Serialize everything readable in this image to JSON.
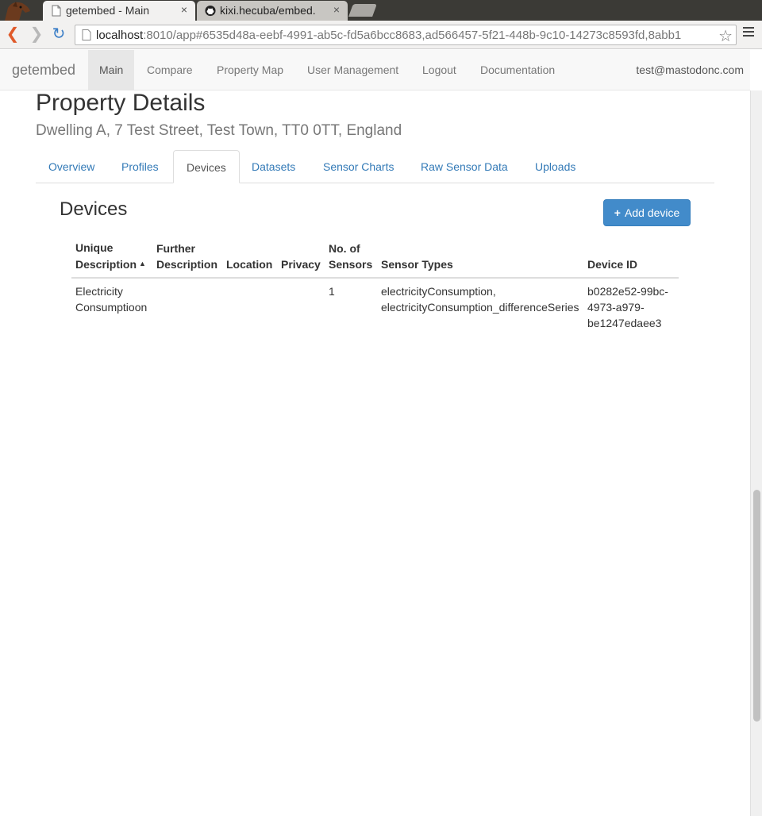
{
  "browser": {
    "tabs": [
      {
        "title": "getembed - Main",
        "close": "×",
        "icon": "page-icon"
      },
      {
        "title": "kixi.hecuba/embed.",
        "close": "×",
        "icon": "github-icon"
      }
    ],
    "url_host": "localhost",
    "url_rest": ":8010/app#6535d48a-eebf-4991-ab5c-fd5a6bcc8683,ad566457-5f21-448b-9c10-14273c8593fd,8abb1",
    "back": "❮",
    "forward": "❯",
    "reload": "↻",
    "star": "☆"
  },
  "navbar": {
    "brand": "getembed",
    "items": [
      "Main",
      "Compare",
      "Property Map",
      "User Management",
      "Logout",
      "Documentation"
    ],
    "active": "Main",
    "user": "test@mastodonc.com"
  },
  "page": {
    "title": "Property Details",
    "subtitle": "Dwelling A, 7 Test Street, Test Town, TT0 0TT, England",
    "tabs": [
      "Overview",
      "Profiles",
      "Devices",
      "Datasets",
      "Sensor Charts",
      "Raw Sensor Data",
      "Uploads"
    ],
    "active_tab": "Devices"
  },
  "devices": {
    "title": "Devices",
    "add_button": {
      "icon": "+",
      "label": "Add device"
    },
    "columns": {
      "unique_description": [
        "Unique",
        "Description"
      ],
      "further_description": [
        "Further",
        "Description"
      ],
      "location": "Location",
      "privacy": "Privacy",
      "no_of_sensors": [
        "No. of",
        "Sensors"
      ],
      "sensor_types": "Sensor Types",
      "device_id": "Device ID"
    },
    "sort_indicator": "▲",
    "rows": [
      {
        "unique_description": [
          "Electricity",
          "Consumptioon"
        ],
        "further_description": "",
        "location": "",
        "privacy": "",
        "no_of_sensors": "1",
        "sensor_types": [
          "electricityConsumption,",
          "electricityConsumption_differenceSeries"
        ],
        "device_id": [
          "b0282e52-99bc-",
          "4973-a979-",
          "be1247edaee3"
        ]
      }
    ]
  },
  "colors": {
    "link": "#337ab7",
    "primary_button": "#428bca",
    "navbar_bg": "#f8f8f8"
  }
}
